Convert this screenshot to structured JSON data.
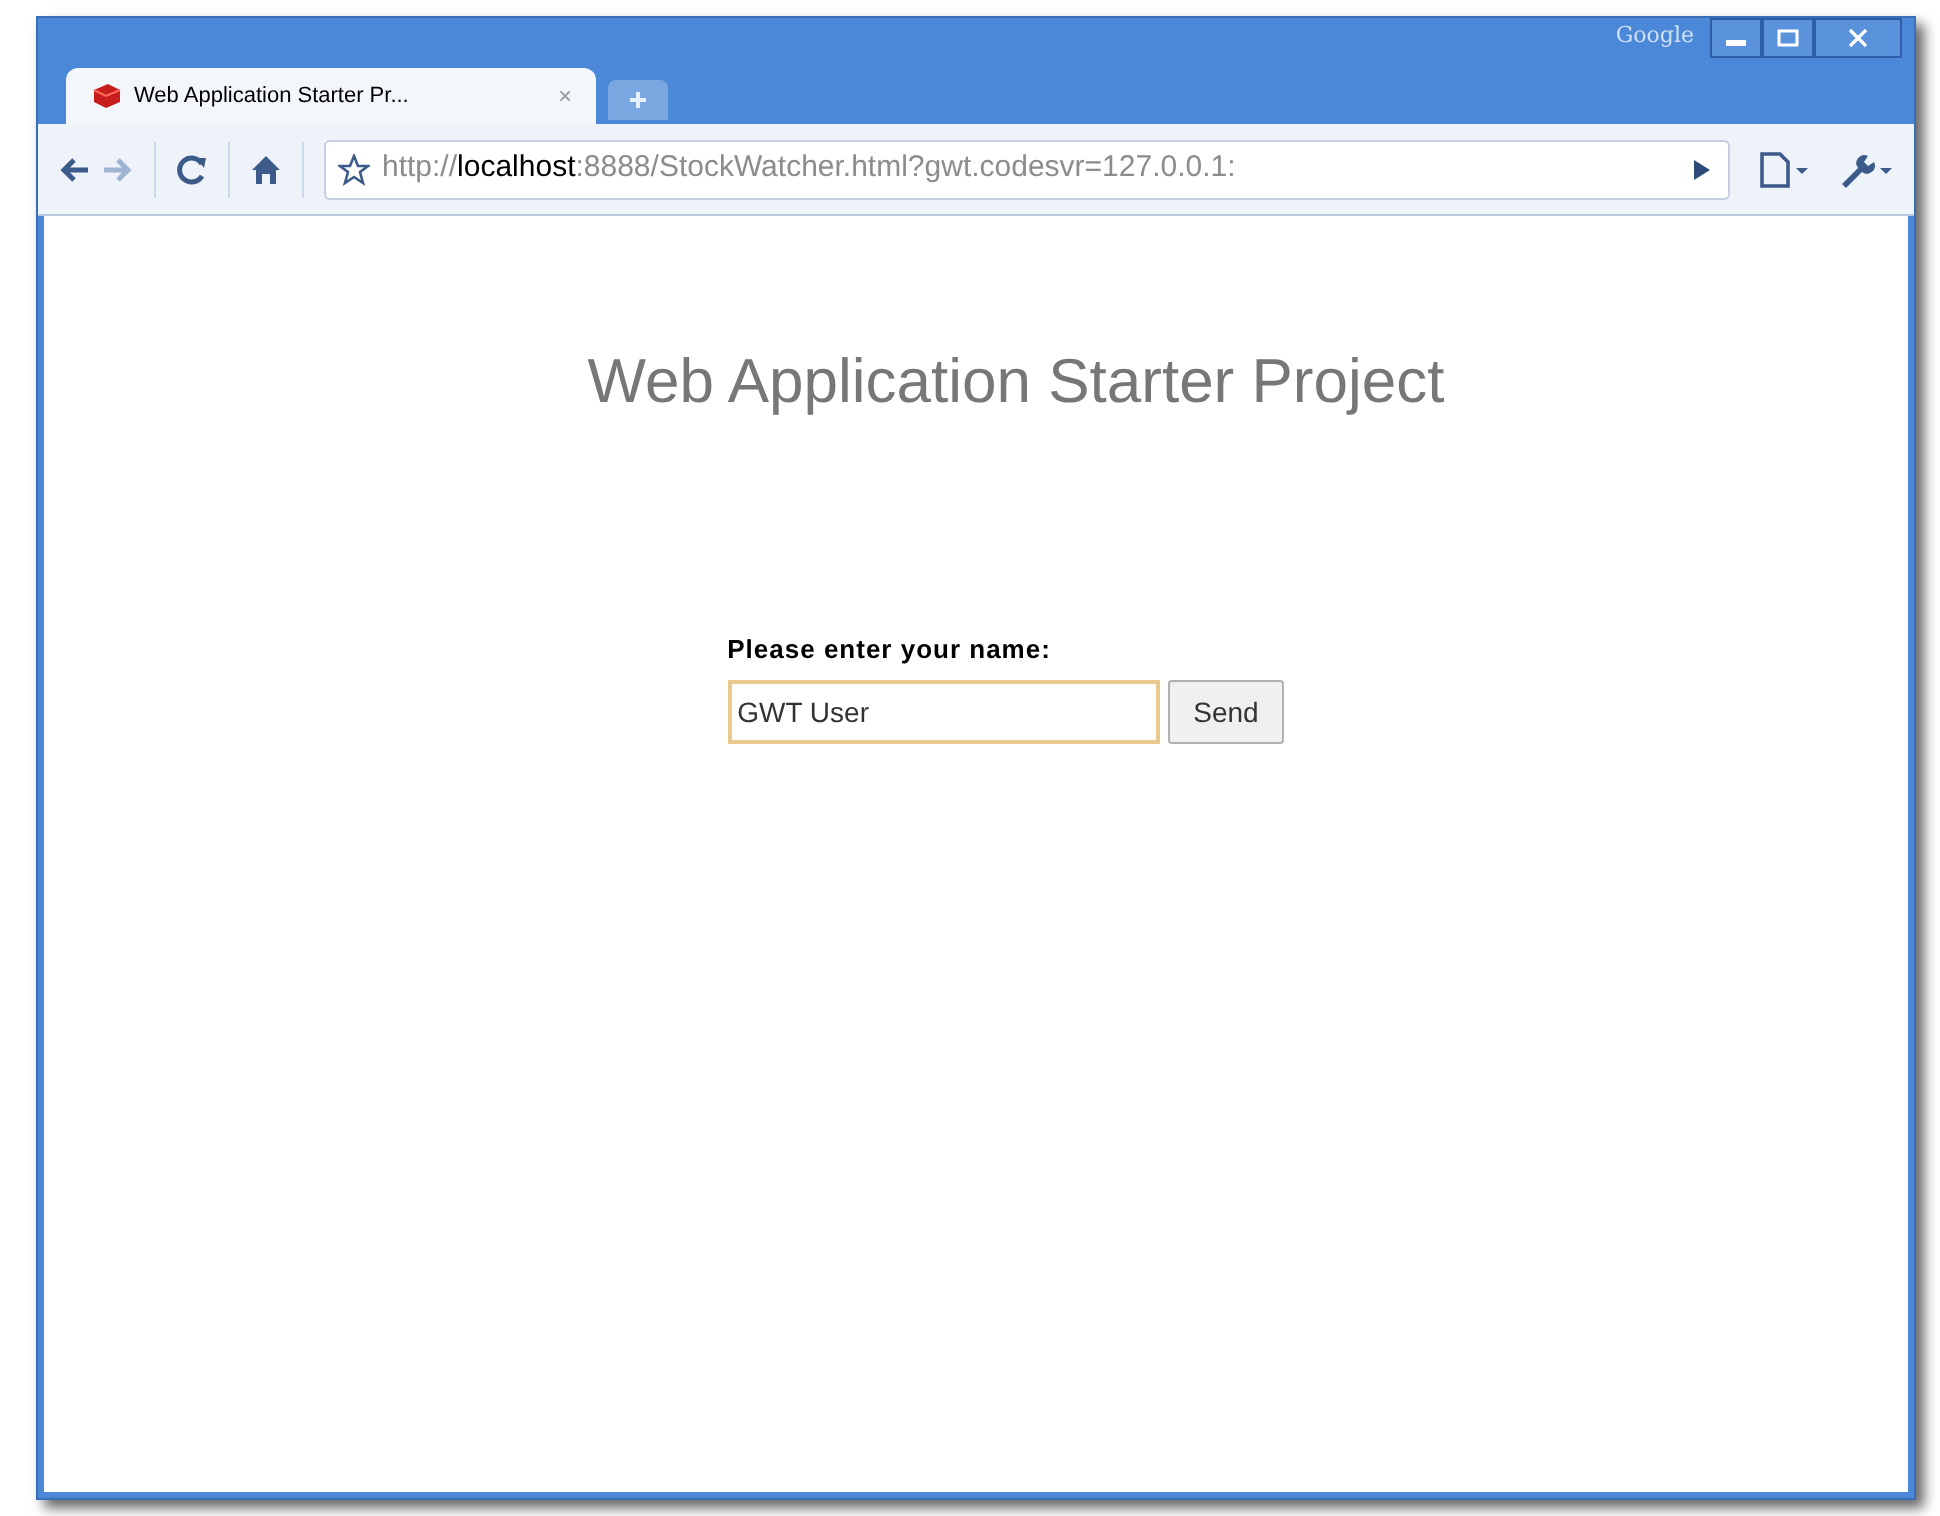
{
  "window": {
    "brand": "Google",
    "controls": [
      {
        "kind": "minimize"
      },
      {
        "kind": "maximize"
      },
      {
        "kind": "close"
      }
    ]
  },
  "tabs": [
    {
      "label": "Web Application Starter Pr...",
      "close": "×",
      "selected": true
    }
  ],
  "toolbar": {
    "url": "http://**localhost**:8888/StockWatcher.html?gwt.codesvr=127.0.0.1:"
  },
  "page": {
    "heading": "Web Application Starter Project",
    "prompt": "Please enter your name:",
    "name_field": {
      "value": "GWT User",
      "focused": true
    },
    "send_button": "Send"
  }
}
